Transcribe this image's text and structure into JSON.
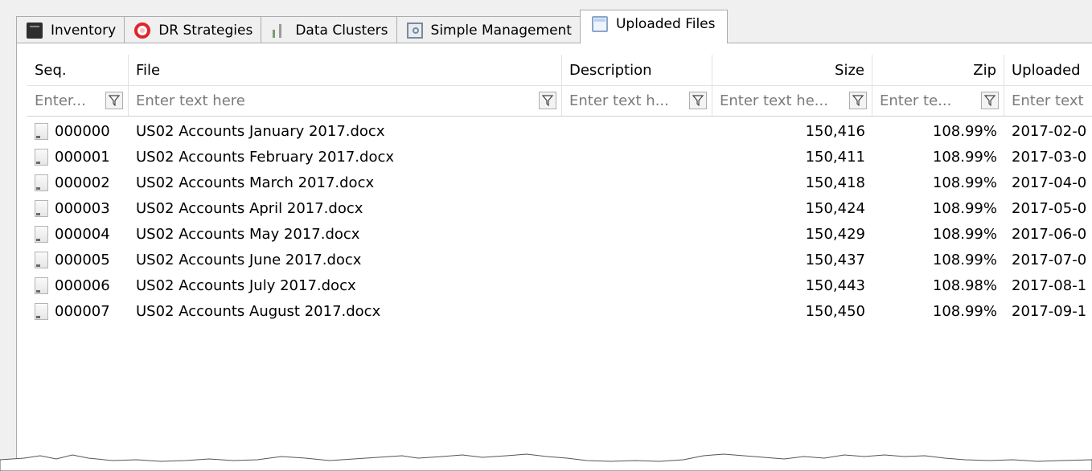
{
  "tabs": [
    {
      "label": "Inventory",
      "icon": "inventory-icon",
      "active": false
    },
    {
      "label": "DR Strategies",
      "icon": "lifebuoy-icon",
      "active": false
    },
    {
      "label": "Data Clusters",
      "icon": "data-clusters-icon",
      "active": false
    },
    {
      "label": "Simple Management",
      "icon": "camera-icon",
      "active": false
    },
    {
      "label": "Uploaded Files",
      "icon": "window-icon",
      "active": true
    }
  ],
  "grid": {
    "columns": [
      "Seq.",
      "File",
      "Description",
      "Size",
      "Zip",
      "Uploaded"
    ],
    "filters": [
      "Enter...",
      "Enter text here",
      "Enter text h...",
      "Enter text he...",
      "Enter te...",
      "Enter text"
    ],
    "rows": [
      {
        "seq": "000000",
        "file": "US02 Accounts January 2017.docx",
        "description": "",
        "size": "150,416",
        "zip": "108.99%",
        "uploaded": "2017-02-0"
      },
      {
        "seq": "000001",
        "file": "US02 Accounts February 2017.docx",
        "description": "",
        "size": "150,411",
        "zip": "108.99%",
        "uploaded": "2017-03-0"
      },
      {
        "seq": "000002",
        "file": "US02 Accounts March 2017.docx",
        "description": "",
        "size": "150,418",
        "zip": "108.99%",
        "uploaded": "2017-04-0"
      },
      {
        "seq": "000003",
        "file": "US02 Accounts April 2017.docx",
        "description": "",
        "size": "150,424",
        "zip": "108.99%",
        "uploaded": "2017-05-0"
      },
      {
        "seq": "000004",
        "file": "US02 Accounts May 2017.docx",
        "description": "",
        "size": "150,429",
        "zip": "108.99%",
        "uploaded": "2017-06-0"
      },
      {
        "seq": "000005",
        "file": "US02 Accounts June 2017.docx",
        "description": "",
        "size": "150,437",
        "zip": "108.99%",
        "uploaded": "2017-07-0"
      },
      {
        "seq": "000006",
        "file": "US02 Accounts July 2017.docx",
        "description": "",
        "size": "150,443",
        "zip": "108.98%",
        "uploaded": "2017-08-1"
      },
      {
        "seq": "000007",
        "file": "US02 Accounts August 2017.docx",
        "description": "",
        "size": "150,450",
        "zip": "108.99%",
        "uploaded": "2017-09-1"
      }
    ]
  },
  "colors": {
    "tab_border": "#acacac",
    "grid_line": "#e2e2e2",
    "placeholder": "#7b7b7b",
    "accent_red": "#e0252a"
  }
}
